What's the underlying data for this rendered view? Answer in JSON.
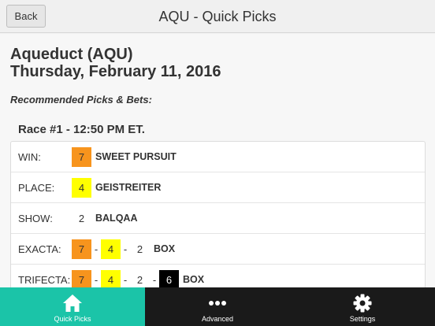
{
  "header": {
    "back_label": "Back",
    "title": "AQU - Quick Picks"
  },
  "main": {
    "track": "Aqueduct (AQU)",
    "date": "Thursday, February 11, 2016",
    "recommended_label": "Recommended Picks & Bets:",
    "race": "Race #1 - 12:50 PM ET.",
    "bets": [
      {
        "type": "WIN:",
        "picks": [
          {
            "num": "7",
            "color": "#f7941d"
          }
        ],
        "label": "SWEET PURSUIT"
      },
      {
        "type": "PLACE:",
        "picks": [
          {
            "num": "4",
            "color": "#ffff00"
          }
        ],
        "label": "GEISTREITER"
      },
      {
        "type": "SHOW:",
        "picks": [
          {
            "num": "2",
            "color": "#ffffff"
          }
        ],
        "label": "BALQAA"
      },
      {
        "type": "EXACTA:",
        "picks": [
          {
            "num": "7",
            "color": "#f7941d"
          },
          {
            "num": "4",
            "color": "#ffff00"
          },
          {
            "num": "2",
            "color": "#ffffff"
          }
        ],
        "label": "BOX"
      },
      {
        "type": "TRIFECTA:",
        "picks": [
          {
            "num": "7",
            "color": "#f7941d"
          },
          {
            "num": "4",
            "color": "#ffff00"
          },
          {
            "num": "2",
            "color": "#ffffff"
          },
          {
            "num": "6",
            "color": "#000000"
          }
        ],
        "label": "BOX"
      }
    ],
    "separator": "-"
  },
  "tabbar": {
    "active_color": "#1bc4a8",
    "tabs": [
      {
        "label": "Quick Picks",
        "icon": "home-icon",
        "active": true
      },
      {
        "label": "Advanced",
        "icon": "more-icon",
        "active": false
      },
      {
        "label": "Settings",
        "icon": "gear-icon",
        "active": false
      }
    ]
  }
}
